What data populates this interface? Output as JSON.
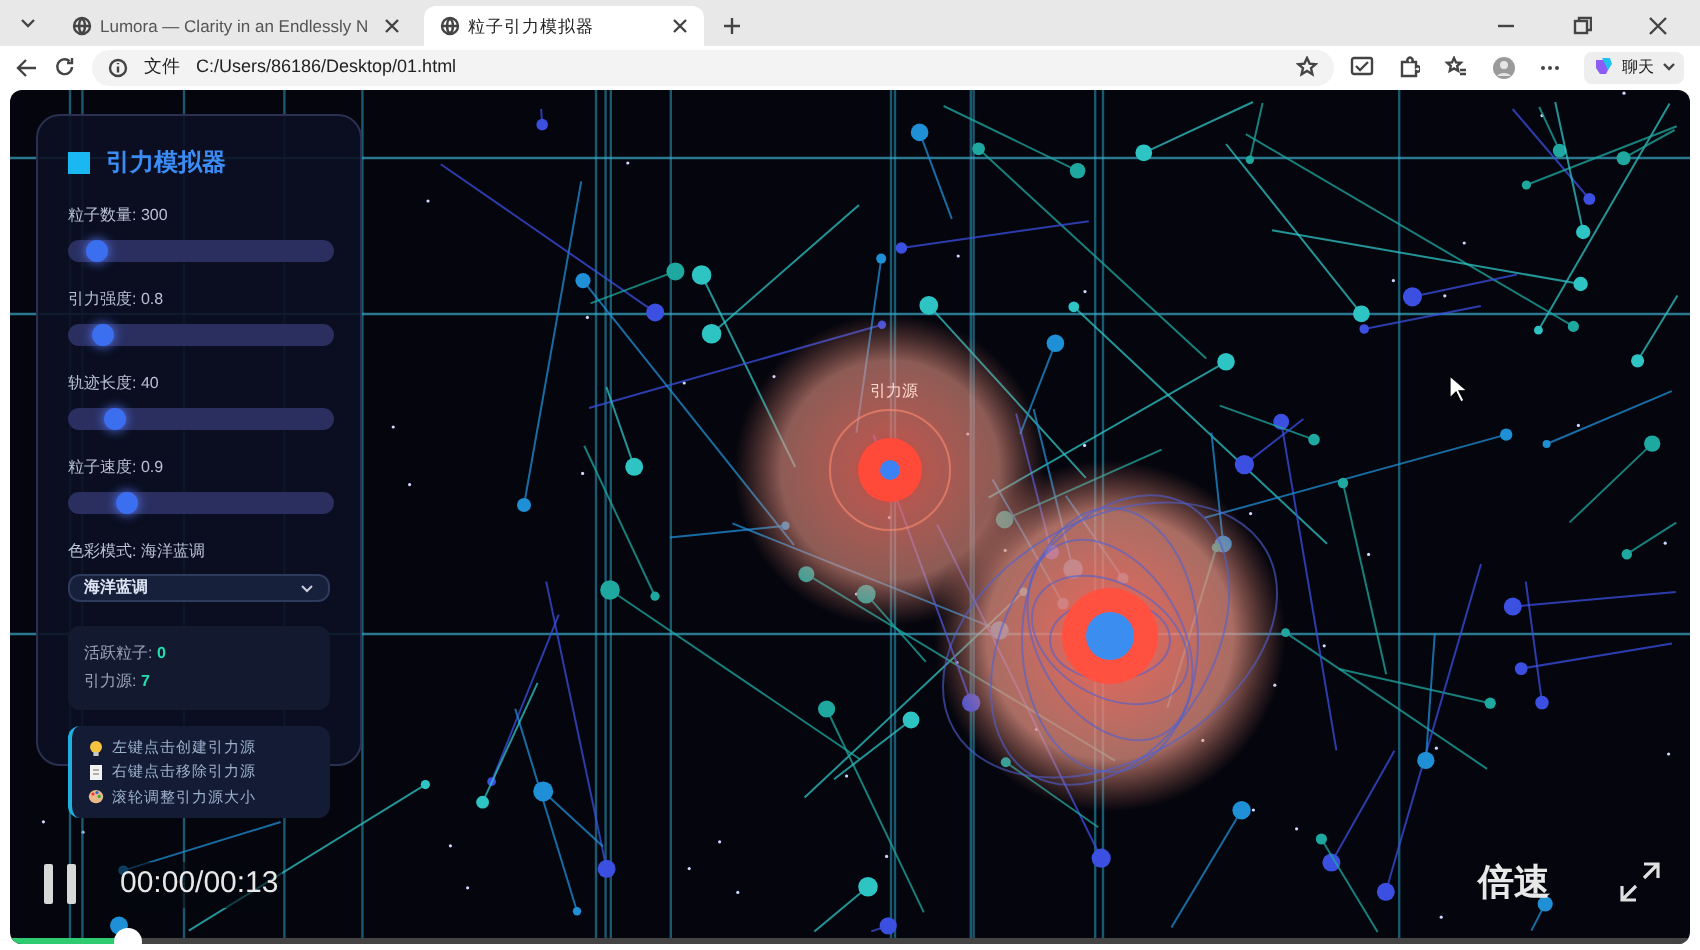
{
  "browser": {
    "tabs": [
      {
        "title": "Lumora — Clarity in an Endlessly N",
        "selected": false
      },
      {
        "title": "粒子引力模拟器",
        "selected": true
      }
    ],
    "address": {
      "scheme_label": "文件",
      "url": "C:/Users/86186/Desktop/01.html"
    },
    "chat_button": "聊天"
  },
  "panel": {
    "title": "引力模拟器",
    "sliders": [
      {
        "label": "粒子数量: 300",
        "level": 0.07
      },
      {
        "label": "引力强度: 0.8",
        "level": 0.1
      },
      {
        "label": "轨迹长度: 40",
        "level": 0.15
      },
      {
        "label": "粒子速度: 0.9",
        "level": 0.2
      }
    ],
    "color_mode_label": "色彩模式: 海洋蓝调",
    "select": {
      "value": "海洋蓝调"
    },
    "stats": [
      {
        "label": "活跃粒子: ",
        "value": "0"
      },
      {
        "label": "引力源: ",
        "value": "7"
      }
    ],
    "tips": [
      {
        "kind": "bulb",
        "text": "左键点击创建引力源"
      },
      {
        "kind": "page",
        "text": "右键点击移除引力源"
      },
      {
        "kind": "palette",
        "text": "滚轮调整引力源大小"
      }
    ]
  },
  "canvas": {
    "source_label": "引力源"
  },
  "player": {
    "playing": true,
    "time": "00:00/00:13",
    "speed_button": "倍速",
    "level": 0.07
  }
}
